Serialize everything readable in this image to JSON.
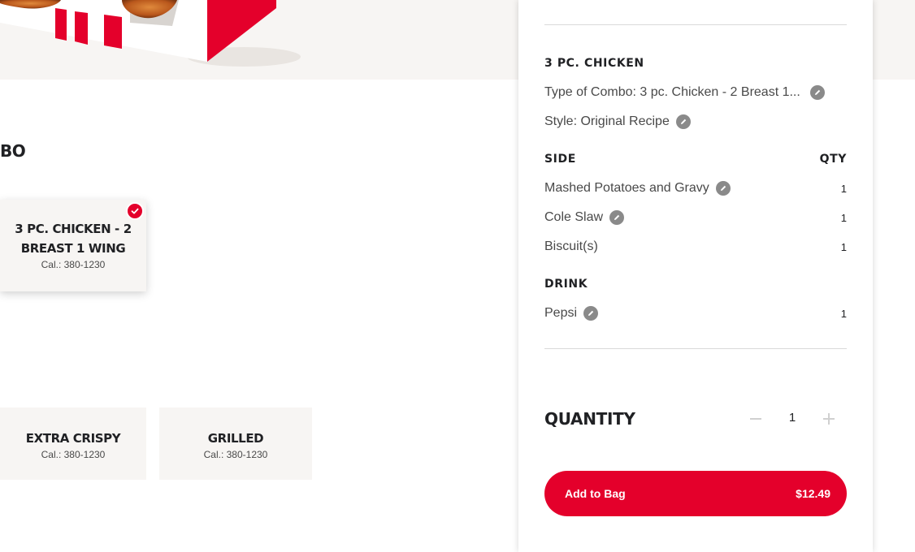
{
  "menu": {
    "section_heading": "BO",
    "selected_card": {
      "title": "3 PC. CHICKEN - 2 BREAST 1 WING",
      "calories": "Cal.: 380-1230"
    },
    "style_cards": [
      {
        "title": "EXTRA CRISPY",
        "calories": "Cal.: 380-1230"
      },
      {
        "title": "GRILLED",
        "calories": "Cal.: 380-1230"
      }
    ]
  },
  "summary": {
    "item_title": "3 PC. CHICKEN",
    "combo_type": "Type of Combo: 3 pc. Chicken - 2 Breast 1...",
    "style": "Style: Original Recipe",
    "side_header": "SIDE",
    "qty_header": "QTY",
    "sides": [
      {
        "name": "Mashed Potatoes and Gravy",
        "qty": "1"
      },
      {
        "name": "Cole Slaw",
        "qty": "1"
      },
      {
        "name": "Biscuit(s)",
        "qty": "1"
      }
    ],
    "drink_header": "DRINK",
    "drinks": [
      {
        "name": "Pepsi",
        "qty": "1"
      }
    ]
  },
  "quantity": {
    "label": "QUANTITY",
    "value": "1"
  },
  "add_to_bag": {
    "label": "Add to Bag",
    "price": "$12.49"
  },
  "colors": {
    "brand_red": "#e4002b",
    "panel_bg": "#f7f5f3",
    "icon_gray": "#8a8a8a"
  },
  "icons": [
    "check-icon",
    "pencil-edit-icon",
    "minus-icon",
    "plus-icon"
  ]
}
